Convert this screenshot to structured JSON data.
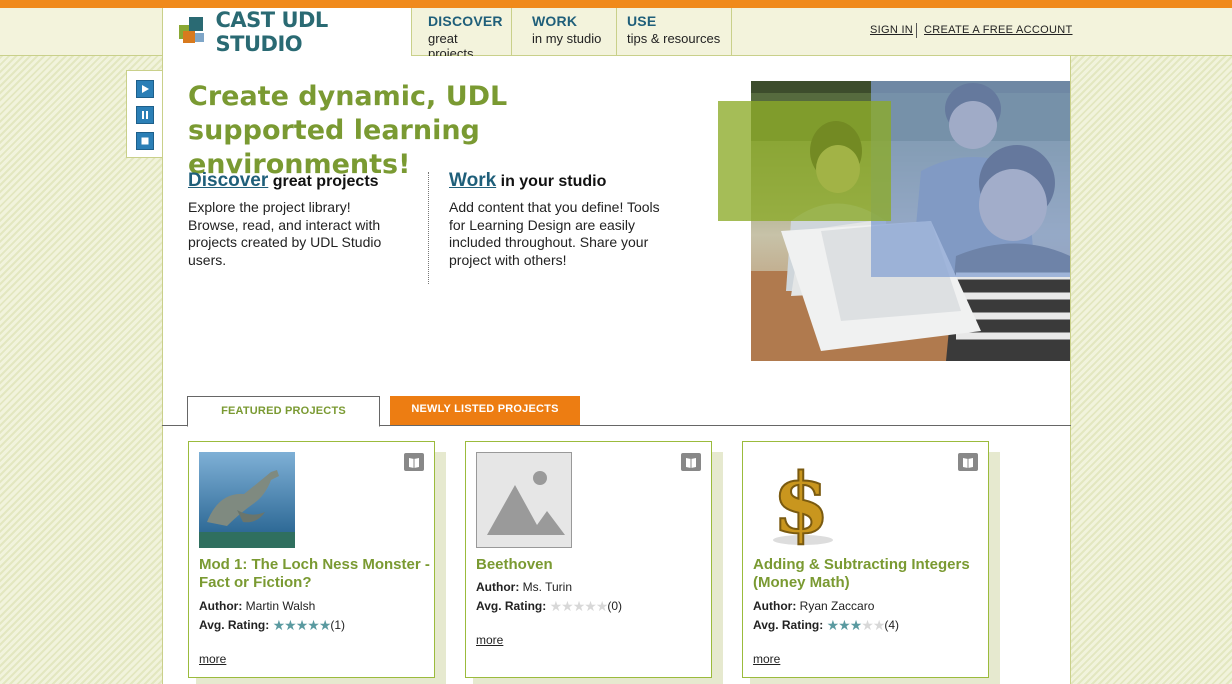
{
  "header": {
    "logo_text": "CAST UDL STUDIO",
    "nav": [
      {
        "title": "DISCOVER",
        "subtitle": "great projects"
      },
      {
        "title": "WORK",
        "subtitle": "in my studio"
      },
      {
        "title": "USE",
        "subtitle": "tips & resources"
      }
    ],
    "sign_in": "SIGN IN",
    "create_account": "CREATE A FREE ACCOUNT"
  },
  "hero": {
    "title": "Create dynamic, UDL supported learning environments!",
    "discover": {
      "link": "Discover",
      "rest": " great projects",
      "body": "Explore the project library! Browse, read, and interact with projects created by UDL Studio users."
    },
    "work": {
      "link": "Work",
      "rest": " in your studio",
      "body": "Add content that you define! Tools for Learning Design are easily included throughout. Share your project with others!"
    }
  },
  "tabs": {
    "featured": "FEATURED PROJECTS",
    "newly_listed": "NEWLY LISTED PROJECTS"
  },
  "projects": [
    {
      "title": "Mod 1: The Loch Ness Monster - Fact or Fiction?",
      "author_label": "Author:",
      "author": "Martin Walsh",
      "rating_label": "Avg. Rating:",
      "rating": 5,
      "rating_count": "(1)",
      "more": "more",
      "thumb_icon": "loch-ness-monster-image"
    },
    {
      "title": "Beethoven",
      "author_label": "Author:",
      "author": "Ms. Turin",
      "rating_label": "Avg. Rating:",
      "rating": 0,
      "rating_count": "(0)",
      "more": "more",
      "thumb_icon": "image-placeholder-icon"
    },
    {
      "title": "Adding & Subtracting Integers (Money Math)",
      "author_label": "Author:",
      "author": "Ryan Zaccaro",
      "rating_label": "Avg. Rating:",
      "rating": 3,
      "rating_count": "(4)",
      "more": "more",
      "thumb_icon": "dollar-sign-image"
    }
  ],
  "colors": {
    "accent_orange": "#ed7d12",
    "brand_green": "#7a9a32",
    "brand_teal": "#1f5f7a",
    "star_filled": "#5a9aa0",
    "star_empty": "#d8d8d8"
  }
}
